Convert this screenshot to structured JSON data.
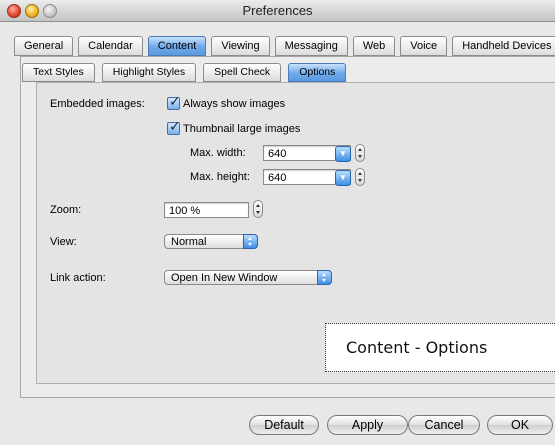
{
  "window": {
    "title": "Preferences"
  },
  "tabs": [
    "General",
    "Calendar",
    "Content",
    "Viewing",
    "Messaging",
    "Web",
    "Voice",
    "Handheld Devices"
  ],
  "active_tab": "Content",
  "subtabs": [
    "Text Styles",
    "Highlight Styles",
    "Spell Check",
    "Options"
  ],
  "active_subtab": "Options",
  "options": {
    "embedded_images_label": "Embedded images:",
    "always_show_images": {
      "label": "Always show images",
      "checked": true
    },
    "thumbnail_large_images": {
      "label": "Thumbnail large images",
      "checked": true
    },
    "max_width": {
      "label": "Max. width:",
      "value": "640"
    },
    "max_height": {
      "label": "Max. height:",
      "value": "640"
    },
    "zoom": {
      "label": "Zoom:",
      "value": "100 %"
    },
    "view": {
      "label": "View:",
      "value": "Normal"
    },
    "link_action": {
      "label": "Link action:",
      "value": "Open In New Window"
    }
  },
  "caption": "Content - Options",
  "buttons": {
    "default": "Default",
    "apply": "Apply",
    "cancel": "Cancel",
    "ok": "OK"
  }
}
